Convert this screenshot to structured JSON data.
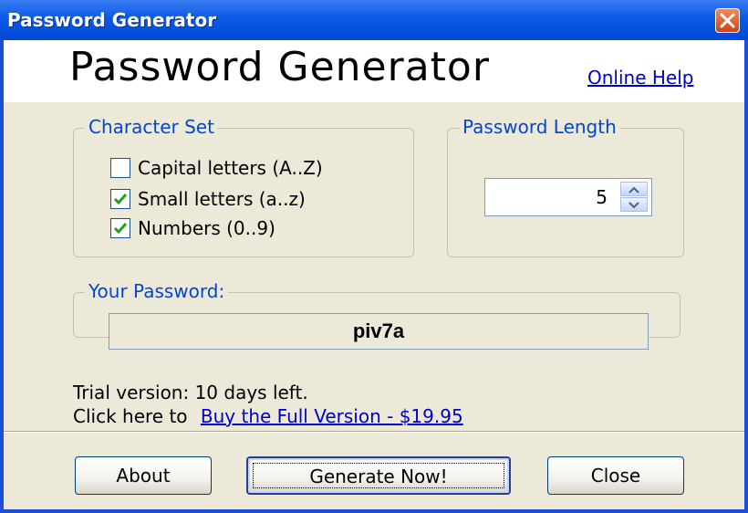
{
  "window": {
    "title": "Password Generator"
  },
  "header": {
    "app_title": "Password Generator",
    "help_link": "Online Help"
  },
  "character_set": {
    "legend": "Character Set",
    "options": [
      {
        "label": "Capital letters (A..Z)",
        "checked": false
      },
      {
        "label": "Small letters (a..z)",
        "checked": true
      },
      {
        "label": "Numbers (0..9)",
        "checked": true
      }
    ]
  },
  "password_length": {
    "legend": "Password Length",
    "value": "5"
  },
  "your_password": {
    "legend": "Your Password:",
    "value": "piv7a"
  },
  "trial": {
    "line1": "Trial version: 10 days left.",
    "line2_prefix": "Click here to",
    "buy_link": "Buy the Full Version - $19.95"
  },
  "buttons": {
    "about": "About",
    "generate": "Generate Now!",
    "close": "Close"
  },
  "colors": {
    "titlebar": "#0a5ae6",
    "legend_text": "#0046d5",
    "link": "#0000cc",
    "dialog_bg": "#ece9d8"
  },
  "icons": {
    "close": "close-icon",
    "check": "checkmark-icon",
    "spin_up": "chevron-up-icon",
    "spin_down": "chevron-down-icon"
  }
}
